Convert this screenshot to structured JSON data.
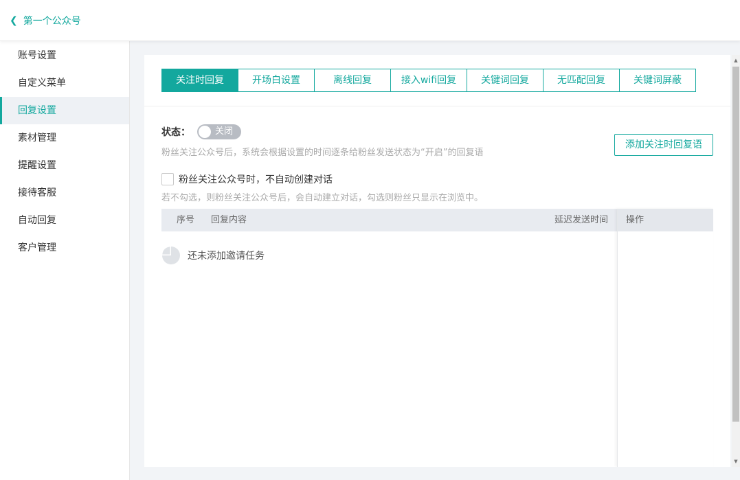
{
  "header": {
    "back_label": "第一个公众号"
  },
  "sidebar": {
    "items": [
      {
        "label": "账号设置"
      },
      {
        "label": "自定义菜单"
      },
      {
        "label": "回复设置"
      },
      {
        "label": "素材管理"
      },
      {
        "label": "提醒设置"
      },
      {
        "label": "接待客服"
      },
      {
        "label": "自动回复"
      },
      {
        "label": "客户管理"
      }
    ],
    "active_index": 2
  },
  "tabs": [
    {
      "label": "关注时回复"
    },
    {
      "label": "开场白设置"
    },
    {
      "label": "离线回复"
    },
    {
      "label": "接入wifi回复"
    },
    {
      "label": "关键词回复"
    },
    {
      "label": "无匹配回复"
    },
    {
      "label": "关键词屏蔽"
    }
  ],
  "status": {
    "label": "状态：",
    "toggle_text": "关闭",
    "hint": "粉丝关注公众号后，系统会根据设置的时间逐条给粉丝发送状态为“开启”的回复语"
  },
  "add_button": "添加关注时回复语",
  "option": {
    "label": "粉丝关注公众号时，不自动创建对话",
    "checked": false,
    "hint": "若不勾选，则粉丝关注公众号后，会自动建立对话，勾选则粉丝只显示在浏览中。"
  },
  "table": {
    "columns": [
      "序号",
      "回复内容",
      "延迟发送时间",
      "操作"
    ],
    "empty_text": "还未添加邀请任务"
  },
  "colors": {
    "accent": "#13a89e"
  }
}
